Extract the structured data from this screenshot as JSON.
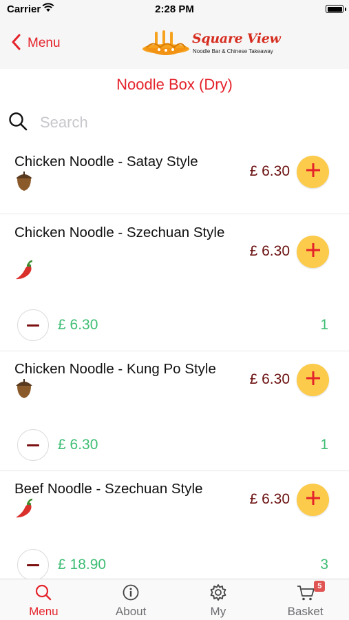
{
  "status_bar": {
    "carrier": "Carrier",
    "time": "2:28 PM"
  },
  "nav": {
    "back_label": "Menu",
    "logo_name": "Square View",
    "logo_tagline": "Noodle Bar & Chinese Takeaway"
  },
  "page_title": "Noodle Box (Dry)",
  "search": {
    "placeholder": "Search",
    "value": ""
  },
  "items": [
    {
      "name": "Chicken Noodle - Satay Style",
      "icon": "acorn-icon",
      "price": "£ 6.30"
    },
    {
      "name": "Chicken Noodle - Szechuan Style",
      "icon": "chili-pepper-icon",
      "price": "£ 6.30",
      "line_total": "£ 6.30",
      "quantity": "1"
    },
    {
      "name": "Chicken Noodle - Kung Po Style",
      "icon": "acorn-icon",
      "price": "£ 6.30",
      "line_total": "£ 6.30",
      "quantity": "1"
    },
    {
      "name": "Beef Noodle - Szechuan Style",
      "icon": "chili-pepper-icon",
      "price": "£ 6.30",
      "line_total": "£ 18.90",
      "quantity": "3"
    }
  ],
  "tabs": [
    {
      "label": "Menu",
      "icon": "search-icon",
      "active": true
    },
    {
      "label": "About",
      "icon": "info-icon",
      "active": false
    },
    {
      "label": "My",
      "icon": "gear-icon",
      "active": false
    },
    {
      "label": "Basket",
      "icon": "cart-icon",
      "active": false,
      "badge": "5"
    }
  ],
  "colors": {
    "accent_red": "#e4232b",
    "add_button_yellow": "#fccb4b",
    "price_maroon": "#6b0f0f",
    "quantity_green": "#3dbd73"
  }
}
